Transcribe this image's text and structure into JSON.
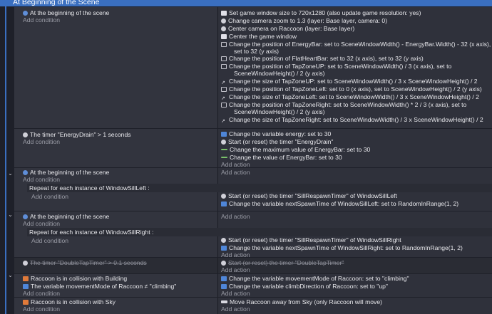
{
  "group": {
    "title": "At Beginning of the Scene"
  },
  "common": {
    "add_condition": "Add condition",
    "add_action": "Add action"
  },
  "event1": {
    "condition": "At the beginning of the scene",
    "actions": [
      "Set game window size to 720x1280 (also update game resolution: yes)",
      "Change camera zoom to 1.3 (layer: Base layer, camera: 0)",
      "Center camera on Raccoon (layer: Base layer)",
      "Center the game window",
      "Change the position of EnergyBar: set to SceneWindowWidth() - EnergyBar.Width() - 32 (x axis),",
      "set to 32 (y axis)",
      "Change the position of FlatHeartBar: set to 32 (x axis), set to 32 (y axis)",
      "Change the position of TapZoneUP: set to SceneWindowWidth() / 3 (x axis), set to",
      "SceneWindowHeight() / 2 (y axis)",
      "Change the size of TapZoneUP: set to SceneWindowWidth() / 3 x SceneWindowHeight() / 2",
      "Change the position of TapZoneLeft: set to 0 (x axis), set to SceneWindowHeight() / 2 (y axis)",
      "Change the size of TapZoneLeft: set to SceneWindowWidth() / 3 x SceneWindowHeight() / 2",
      "Change the position of TapZoneRight: set to SceneWindowWidth() * 2 / 3 (x axis), set to",
      "SceneWindowHeight() / 2 (y axis)",
      "Change the size of TapZoneRight: set to SceneWindowWidth() / 3 x SceneWindowHeight() / 2"
    ]
  },
  "event2": {
    "condition": "The timer \"EnergyDrain\" > 1 seconds",
    "actions": [
      "Change the variable energy: set to 30",
      "Start (or reset) the timer \"EnergyDrain\"",
      "Change the maximum value of EnergyBar: set to 30",
      "Change the value of EnergyBar: set to 30"
    ]
  },
  "event3": {
    "condition": "At the beginning of the scene",
    "repeat": "Repeat for each instance of WindowSillLeft :",
    "actions": [
      "Start (or reset) the timer \"SillRespawnTimer\" of WindowSillLeft",
      "Change the variable nextSpawnTime of WindowSillLeft: set to RandomInRange(1, 2)"
    ]
  },
  "event4": {
    "condition": "At the beginning of the scene",
    "repeat": "Repeat for each instance of WindowSillRight :",
    "actions": [
      "Start (or reset) the timer \"SillRespawnTimer\" of WindowSillRight",
      "Change the variable nextSpawnTime of WindowSillRight: set to RandomInRange(1, 2)"
    ]
  },
  "event5": {
    "condition": "The timer \"DoubleTapTimer\" > 0.1 seconds",
    "action": "Start (or reset) the timer \"DoubleTapTimer\""
  },
  "event6": {
    "conditions": [
      "Raccoon is in collision with Building",
      "The variable movementMode of Raccoon ≠ \"climbing\""
    ],
    "actions": [
      "Change the variable movementMode of Raccoon: set to \"climbing\"",
      "Change the variable climbDirection of Raccoon: set to \"up\""
    ]
  },
  "event7": {
    "condition": "Raccoon is in collision with Sky",
    "action": "Move Raccoon away from Sky (only Raccoon will move)"
  },
  "colors": {
    "group": "#3a6fc0",
    "tapzone_up": "#e03030",
    "tapzone_left": "#f08a20",
    "tapzone_right": "#c040e0",
    "window_sill": "#38c8e8",
    "building": "#e8b030",
    "sky": "#38c8e8"
  }
}
